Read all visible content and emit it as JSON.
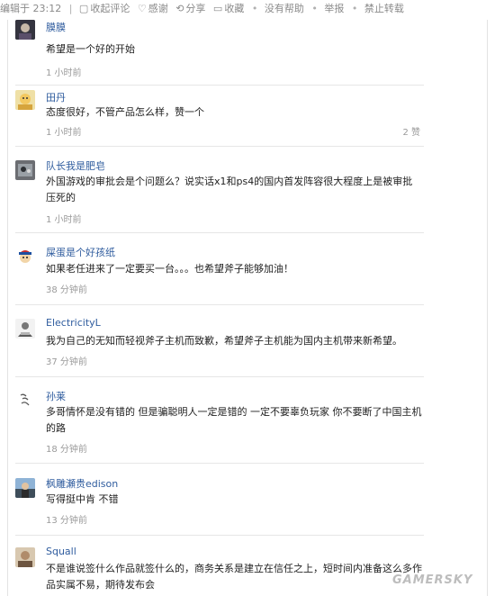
{
  "topbar": {
    "edit_time": "编辑于 23:12",
    "collapse": "收起评论",
    "thanks": "感谢",
    "share": "分享",
    "favorite": "收藏",
    "not_helpful": "没有帮助",
    "report": "举报",
    "no_repost": "禁止转载"
  },
  "comments": [
    {
      "name": "膜膜",
      "text": "希望是一个好的开始",
      "time": "1 小时前",
      "likes": ""
    },
    {
      "name": "田丹",
      "text": "态度很好，不管产品怎么样，赞一个",
      "time": "1 小时前",
      "likes": "2 赞"
    },
    {
      "name": "队长我是肥皂",
      "text": "外国游戏的审批会是个问题么？说实话x1和ps4的国内首发阵容很大程度上是被审批压死的",
      "time": "1 小时前",
      "likes": ""
    },
    {
      "name": "屎蛋是个好孩纸",
      "text": "如果老任进来了一定要买一台。。。也希望斧子能够加油！",
      "time": "38 分钟前",
      "likes": ""
    },
    {
      "name": "ElectricityL",
      "text": "我为自己的无知而轻视斧子主机而致歉，希望斧子主机能为国内主机带来新希望。",
      "time": "37 分钟前",
      "likes": ""
    },
    {
      "name": "孙莱",
      "text": "多哥情怀是没有错的 但是骗聪明人一定是错的 一定不要辜负玩家 你不要断了中国主机的路",
      "time": "18 分钟前",
      "likes": ""
    },
    {
      "name": "枫雕瀬贵edison",
      "text": "写得挺中肯 不错",
      "time": "13 分钟前",
      "likes": ""
    },
    {
      "name": "Squall",
      "text": "不是谁说签什么作品就签什么的，商务关系是建立在信任之上，短时间内准备这么多作品实属不易，期待发布会",
      "time": "",
      "likes": ""
    }
  ],
  "watermark": "GAMERSKY",
  "colors": {
    "name_link": "#2f5c9e",
    "meta_grey": "#9a9a9a"
  }
}
